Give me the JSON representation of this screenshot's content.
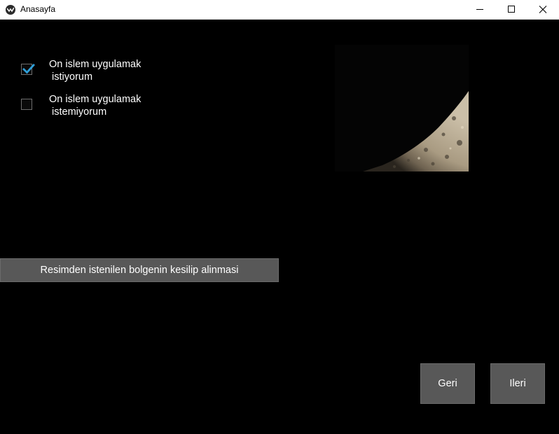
{
  "window": {
    "title": "Anasayfa"
  },
  "options": [
    {
      "label": "On islem uygulamak\n istiyorum",
      "checked": true
    },
    {
      "label": "On islem uygulamak\n istemiyorum",
      "checked": false
    }
  ],
  "colors": {
    "accent": "#2f9fd8",
    "button_bg": "#585858",
    "background": "#000000"
  },
  "actions": {
    "crop_label": "Resimden istenilen bolgenin kesilip alinmasi",
    "back_label": "Geri",
    "next_label": "Ileri"
  }
}
